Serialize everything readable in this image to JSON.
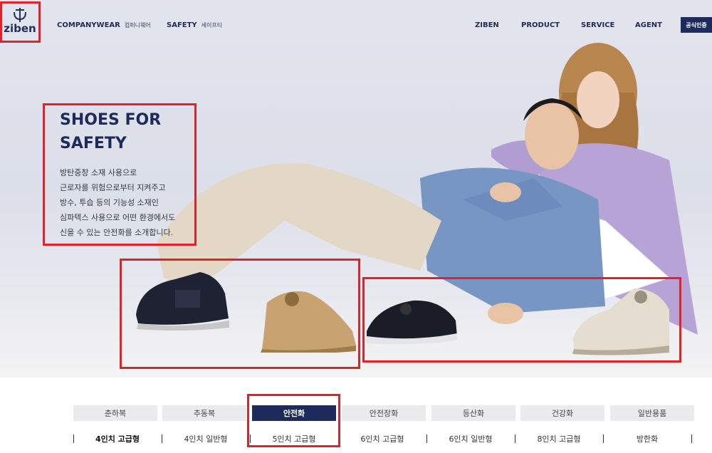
{
  "brand": {
    "name": "ziben"
  },
  "header": {
    "left_nav": [
      {
        "label": "COMPANYWEAR",
        "sub": "컴퍼니웨어"
      },
      {
        "label": "SAFETY",
        "sub": "세이프티"
      }
    ],
    "right_nav": [
      "ZIBEN",
      "PRODUCT",
      "SERVICE",
      "AGENT"
    ],
    "cert_button": "공식인증"
  },
  "hero": {
    "title_line1": "SHOES FOR",
    "title_line2": "SAFETY",
    "description": [
      "방탄중창 소재 사용으로",
      "근로자를 위험으로부터 지켜주고",
      "방수, 투습 등의 기능성 소재인",
      "심파텍스 사용으로 어떤 환경에서도",
      "신을 수 있는 안전화를 소개합니다."
    ]
  },
  "category_tabs": [
    {
      "label": "춘하복",
      "active": false
    },
    {
      "label": "추동복",
      "active": false
    },
    {
      "label": "안전화",
      "active": true
    },
    {
      "label": "안전장화",
      "active": false
    },
    {
      "label": "등산화",
      "active": false
    },
    {
      "label": "건강화",
      "active": false
    },
    {
      "label": "일반용품",
      "active": false
    }
  ],
  "sub_tabs": [
    {
      "label": "4인치 고급형",
      "active": true
    },
    {
      "label": "4인치 일반형",
      "active": false
    },
    {
      "label": "5인치 고급형",
      "active": false
    },
    {
      "label": "6인치 고급형",
      "active": false
    },
    {
      "label": "6인치 일반형",
      "active": false
    },
    {
      "label": "8인치 고급형",
      "active": false
    },
    {
      "label": "방한화",
      "active": false
    }
  ],
  "colors": {
    "brand_navy": "#1d2a5c",
    "highlight_red": "#e0222b",
    "tab_gray": "#ebebed"
  }
}
